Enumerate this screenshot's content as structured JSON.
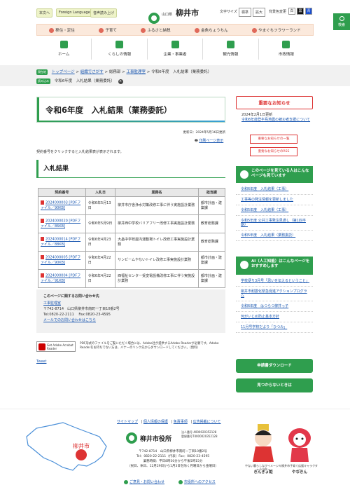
{
  "header": {
    "util_links": [
      "本文へ",
      "Foreign Language",
      "音声読み上げ"
    ],
    "logo_pref": "山口県",
    "logo_city": "柳井市",
    "logo_en": "Yanai City",
    "size_label": "文字サイズ",
    "size_buttons": [
      "標準",
      "拡大"
    ],
    "color_label": "背景色変更",
    "color_buttons": [
      "白",
      "黒",
      "青"
    ],
    "search_label": "検索"
  },
  "band_links": [
    "移住・定住",
    "子育て",
    "ふるさと納税",
    "金魚ちょうちん",
    "やまぐちフラワーランド"
  ],
  "main_nav": [
    "ホーム",
    "くらしの情報",
    "企業・事業者",
    "観光情報",
    "市政情報"
  ],
  "breadcrumb": {
    "badge": "現在地",
    "items": [
      "トップページ",
      "組織でさがす",
      "総務部",
      "工事監理室",
      "令和6年度　入札結果（業務委託）"
    ],
    "badge2": "読み込み",
    "current": "令和6年度　入札結果（業務委託）"
  },
  "page": {
    "title": "令和6年度　入札結果（業務委託）",
    "updated": "更新日：2024年5月16日更新",
    "print": "印刷ページ表示",
    "intro": "契約番号をクリックすると入札結果表が表示されます。",
    "section": "入札結果"
  },
  "table": {
    "headers": [
      "契約番号",
      "入札日",
      "業務名",
      "担当課"
    ],
    "rows": [
      {
        "no": "2024000003 [PDFファイル／90KB]",
        "date": "令和6年5月13日",
        "name": "柳井市庁舎浄水対策改修工事に伴う実施設計業務",
        "dept": "都市計画・建築課"
      },
      {
        "no": "2024000020 [PDFファイル／86KB]",
        "date": "令和6年5月9日",
        "name": "柳井西中学校バリアフリー改修工事実施設計業務",
        "dept": "教育総務課"
      },
      {
        "no": "2024000014 [PDFファイル／88KB]",
        "date": "令和6年4月23日",
        "name": "大畠中学校屋内運動場トイレ改修工事実施設計業務",
        "dept": "教育総務課"
      },
      {
        "no": "2024000005 [PDFファイル／90KB]",
        "date": "令和6年4月22日",
        "name": "サンビームやないトイレ改修工事実施設計業務",
        "dept": "都市計画・建築課"
      },
      {
        "no": "2024000004 [PDFファイル／91KB]",
        "date": "令和6年4月22日",
        "name": "西福祉センター受変電設備改修工事に伴う実施設計業務",
        "dept": "都市計画・建築課"
      }
    ]
  },
  "contact": {
    "title": "このページに関するお問い合わせ先",
    "dept_link": "工事監理室",
    "dept_text": "工事監理室　内線 444",
    "address": "〒742-8714　山口県柳井市南町一丁目10番2号",
    "tel": "Tel:0820-22-2111　 Fax:0820-23-4595",
    "mail": "メールでのお問い合わせはこちら"
  },
  "acrobat": {
    "badge": "Get Adobe Acrobat Reader",
    "text": "PDF形式のファイルをご覧いただく場合には、Adobe社が提供するAdobe Readerが必要です。Adobe Readerをお持ちでない方は、バナーのリンク先からダウンロードしてください。（無料）"
  },
  "tweet": "Tweet",
  "sidebar": {
    "notice_title": "重要なお知らせ",
    "notice_date": "2024年2月1日更新",
    "notice_link": "令和6年能登半島地震の被災者支援について",
    "notice_btn1": "重要なお知らせの一覧",
    "notice_btn2": "重要なお知らせのRSS",
    "viewed_title": "このページを見ている人はこんなページも見ています",
    "viewed_links": [
      "令和6年度　入札結果（工事）",
      "工事等の発注情報を更新しました",
      "令和5年度　入札結果（工事）",
      "令和5年度 公共工事発注見通し（第1四半期）",
      "令和5年度　入札結果（業務委託）"
    ],
    "ai_title": "AI（人工知能）はこんなページをおすすめします",
    "ai_links": [
      "学校便り3月号「思いを伝えるということ」",
      "柳井市耐震化緊急促進アクションプログラム",
      "令和6年度　はつらつ柳井っ子",
      "何がいじめ防止基本方針",
      "11月号学校だより「ひつみ」"
    ],
    "btn_download": "申請書ダウンロード",
    "btn_notfound": "見つからないときは"
  },
  "footer": {
    "nav": [
      "サイトマップ",
      "個人情報の保護",
      "免責事項",
      "広告掲載について"
    ],
    "map_label": "柳井市",
    "office": "柳井市役所",
    "corp_no": "法人番号 4000020352128",
    "reg_no": "登録番号T4000020352128",
    "address": "〒742-8714　山口県柳井市南町一丁目10番2号",
    "tel": "Tel：0820-22-2111（代表）Fax：0820-23-4595",
    "hours": "業務時間：平日8時30分から午後5時15分",
    "hours2": "（祝日、休日、12月29日から1月3日を除く月曜日から金曜日）",
    "btn_contact": "ご意見・お問い合わせ",
    "btn_access": "市役所へのアクセス",
    "mascot1_desc": "やない暮らしなびイメージキャラクター",
    "mascot1_name": "きんぎょ姫",
    "mascot2_desc": "柳井市子育て応援キャラクター",
    "mascot2_name": "やなきん"
  },
  "colors": {
    "brand": "#2f9e4e",
    "alert": "#dd3333",
    "link": "#1a57b0"
  }
}
